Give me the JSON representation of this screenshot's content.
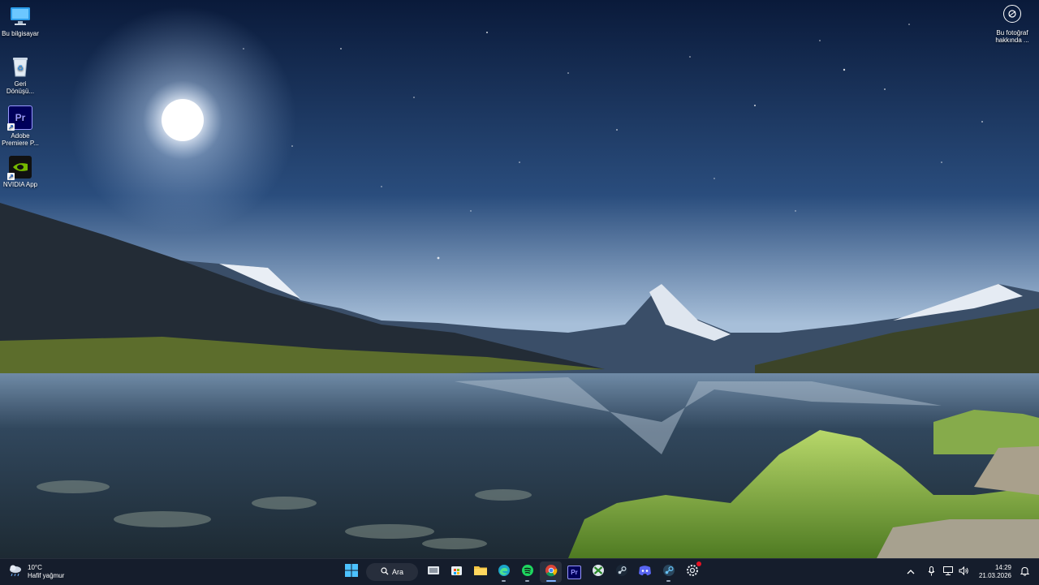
{
  "desktop": {
    "icons": [
      {
        "label": "Bu bilgisayar"
      },
      {
        "label": "Geri Dönüşü..."
      },
      {
        "label": "Adobe Premiere P..."
      },
      {
        "label": "NVIDIA App"
      }
    ],
    "about_photo": {
      "label": "Bu fotoğraf hakkında ..."
    }
  },
  "taskbar": {
    "weather": {
      "temp": "10°C",
      "desc": "Hafif yağmur"
    },
    "search": {
      "label": "Ara"
    },
    "apps": [
      "start-icon",
      "search",
      "task-view-icon",
      "microsoft-store-icon",
      "file-explorer-icon",
      "edge-icon",
      "spotify-icon",
      "chrome-icon",
      "premiere-pro-icon",
      "xbox-icon",
      "steam-icon",
      "discord-icon",
      "steam-alt-icon",
      "settings-icon"
    ],
    "tray": {
      "time": "14:29",
      "date": "21.03.2026"
    }
  },
  "colors": {
    "taskbar": "#161e2c",
    "accent": "#7fb3ff"
  }
}
